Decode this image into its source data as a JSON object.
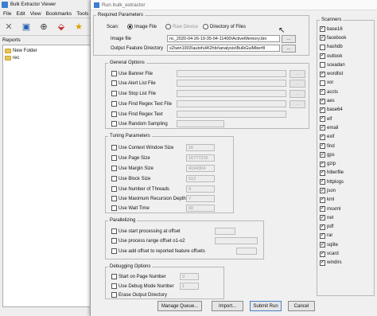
{
  "bg": {
    "title": "Bulk Extractor Viewer",
    "menu": [
      "File",
      "Edit",
      "View",
      "Bookmarks",
      "Tools"
    ],
    "toolbar_icons": [
      "close-icon",
      "save-icon",
      "add-icon",
      "bookmark-icon",
      "star-icon"
    ],
    "reports_label": "Reports",
    "tree": [
      "New Folder",
      "rec"
    ]
  },
  "dialog": {
    "title": "Run bulk_extractor",
    "required": {
      "legend": "Required Parameters",
      "scan_label": "Scan:",
      "radio_image": "Image File",
      "radio_raw": "Raw Device",
      "radio_dir": "Directory of Files",
      "image_label": "Image file",
      "image_value": "nc_2020-04-26-19-35-04-11400\\ActiveMemory.bin",
      "output_label": "Output Feature Directory",
      "output_value": "s2\\win1903\\autoful4\\2hbr\\analysis\\BulkGuiMberfil",
      "browse": "..."
    },
    "general": {
      "legend": "General Options",
      "items": [
        "Use Banner File",
        "Use Alert List File",
        "Use Stop List File",
        "Use Find Regex Text File",
        "Use Find Regex Text",
        "Use Random Sampling"
      ],
      "browse": "..."
    },
    "tuning": {
      "legend": "Tuning Parameters",
      "items": [
        {
          "label": "Use Context Window Size",
          "value": "16"
        },
        {
          "label": "Use Page Size",
          "value": "16777216"
        },
        {
          "label": "Use Margin Size",
          "value": "4194304"
        },
        {
          "label": "Use Block Size",
          "value": "512"
        },
        {
          "label": "Use Number of Threads",
          "value": "4"
        },
        {
          "label": "Use Maximum Recursion Depth",
          "value": "7"
        },
        {
          "label": "Use Wait Time",
          "value": "60"
        }
      ]
    },
    "parallel": {
      "legend": "Parallelizing",
      "items": [
        "Use start processing at offset",
        "Use process range offset o1-o2",
        "Use add offset to reported feature offsets"
      ]
    },
    "debug": {
      "legend": "Debugging Options",
      "items": [
        {
          "label": "Start on Page Number",
          "value": "0"
        },
        {
          "label": "Use Debug Mode Number",
          "value": "1"
        },
        {
          "label": "Erase Output Directory",
          "value": ""
        }
      ]
    },
    "scanners": {
      "legend": "Scanners",
      "items": [
        "base16",
        "facebook",
        "hashdb",
        "outlook",
        "sceadan",
        "wordlist",
        "xor",
        "accts",
        "aes",
        "base64",
        "elf",
        "email",
        "exif",
        "find",
        "gps",
        "gzip",
        "hiberfile",
        "httplogs",
        "json",
        "kml",
        "msxml",
        "net",
        "pdf",
        "rar",
        "sqlite",
        "vcard",
        "windirs"
      ],
      "checked": [
        true,
        true,
        false,
        true,
        false,
        true,
        false,
        true,
        true,
        true,
        true,
        true,
        true,
        true,
        true,
        true,
        true,
        true,
        true,
        true,
        true,
        true,
        true,
        true,
        true,
        true,
        true
      ]
    },
    "buttons": {
      "manage_queue": "Manage Queue...",
      "import": "Import...",
      "submit_run": "Submit Run",
      "cancel": "Cancel"
    }
  }
}
